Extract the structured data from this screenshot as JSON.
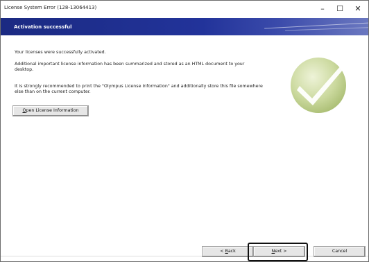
{
  "window": {
    "title": "License System Error (128-13064413)",
    "controls": {
      "minimize": "–",
      "maximize": "☐",
      "close": "✕"
    }
  },
  "banner": {
    "title": "Activation successful"
  },
  "content": {
    "line1": "Your licenses were successfully activated.",
    "line2a": "Additional important license information has been summarized and stored as an HTML document to your",
    "line2b": "desktop.",
    "line3a": "It is strongly recommended to print the \"Olympus License Information\" and additionally store this file somewhere",
    "line3b": "else than on the current computer."
  },
  "buttons": {
    "open_license": {
      "mnemonic": "O",
      "rest": "pen License Information"
    },
    "back": {
      "prefix": "< ",
      "mnemonic": "B",
      "rest": "ack"
    },
    "next": {
      "mnemonic": "N",
      "rest": "ext >"
    },
    "cancel": "Cancel"
  },
  "icons": {
    "success": "checkmark-success-icon"
  },
  "colors": {
    "banner": "#1b2a82",
    "check_circle": "#c8d79a"
  }
}
